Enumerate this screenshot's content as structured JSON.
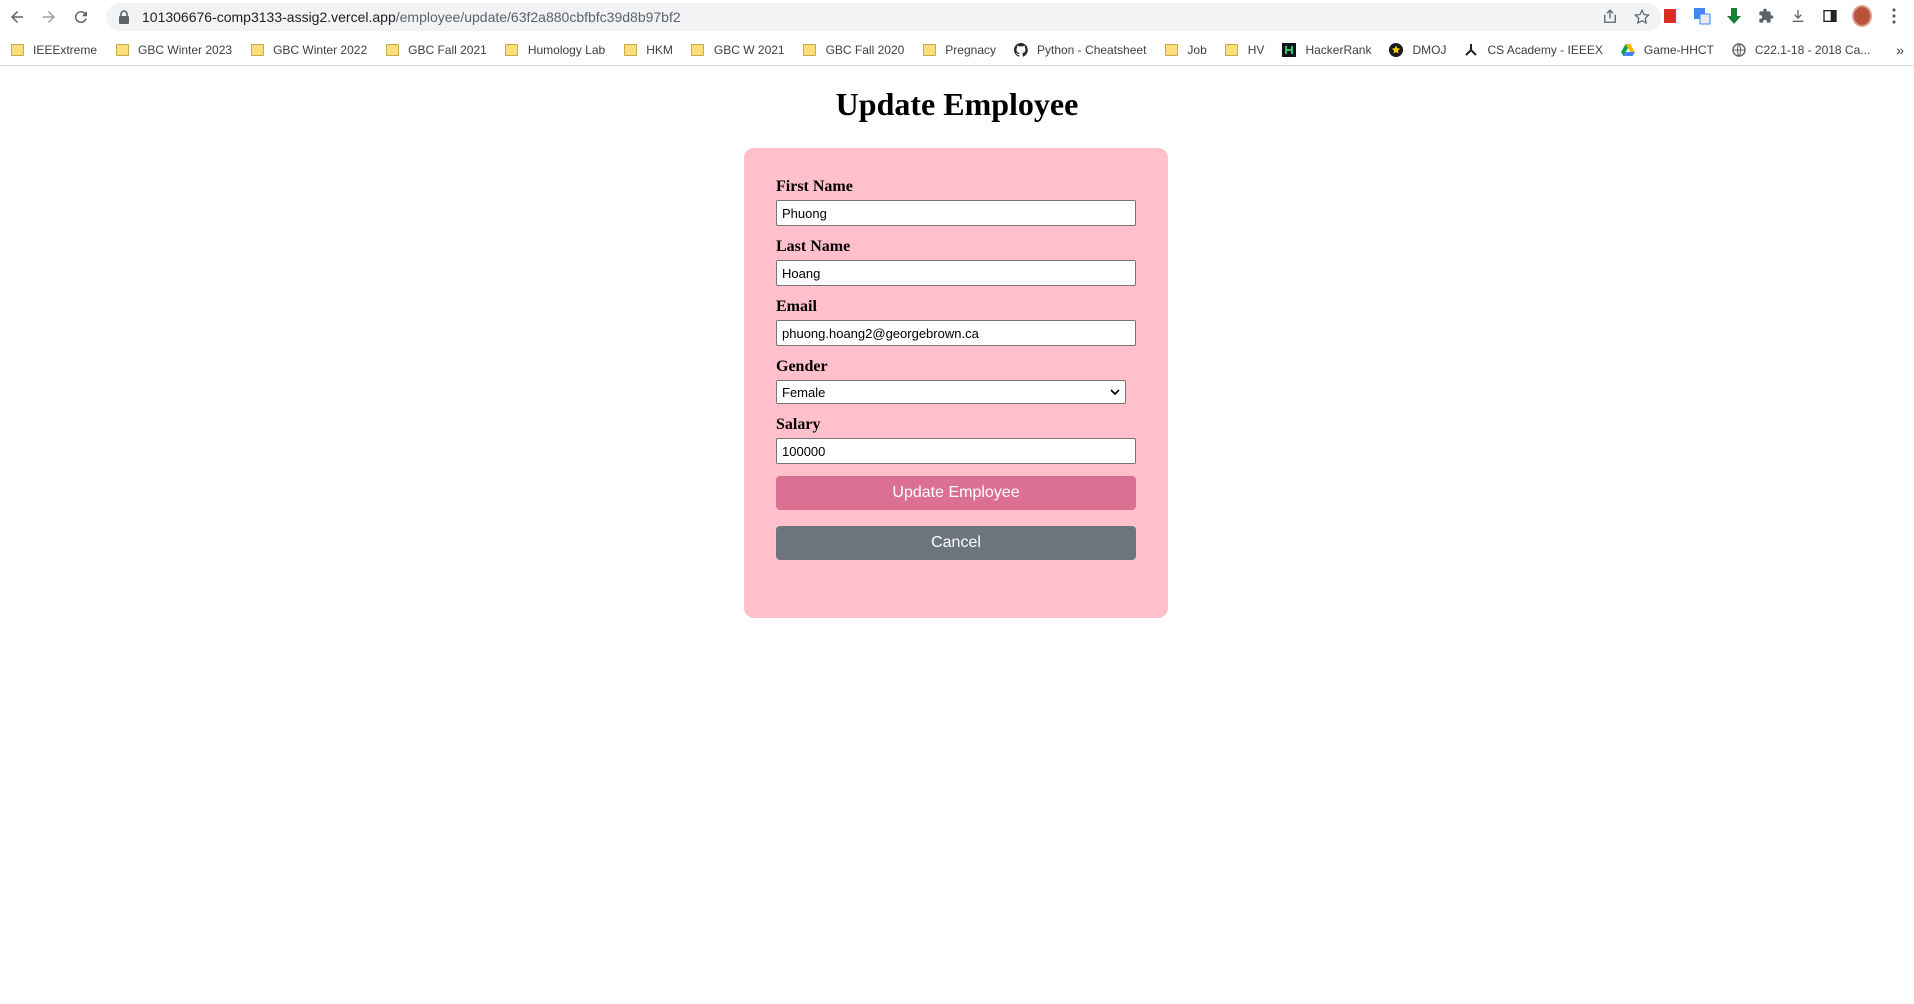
{
  "browser": {
    "url_host": "101306676-comp3133-assig2.vercel.app",
    "url_path": "/employee/update/63f2a880cbfbfc39d8b97bf2",
    "bookmarks": [
      {
        "label": "IEEExtreme",
        "icon": "folder-icon"
      },
      {
        "label": "GBC Winter 2023",
        "icon": "folder-icon"
      },
      {
        "label": "GBC Winter 2022",
        "icon": "folder-icon"
      },
      {
        "label": "GBC Fall 2021",
        "icon": "folder-icon"
      },
      {
        "label": "Humology Lab",
        "icon": "folder-icon"
      },
      {
        "label": "HKM",
        "icon": "folder-icon"
      },
      {
        "label": "GBC W 2021",
        "icon": "folder-icon"
      },
      {
        "label": "GBC Fall 2020",
        "icon": "folder-icon"
      },
      {
        "label": "Pregnacy",
        "icon": "folder-icon"
      },
      {
        "label": "Python - Cheatsheet",
        "icon": "github-icon"
      },
      {
        "label": "Job",
        "icon": "folder-icon"
      },
      {
        "label": "HV",
        "icon": "folder-icon"
      },
      {
        "label": "HackerRank",
        "icon": "hackerrank-icon"
      },
      {
        "label": "DMOJ",
        "icon": "dmoj-icon"
      },
      {
        "label": "CS Academy - IEEEX",
        "icon": "csacademy-icon"
      },
      {
        "label": "Game-HHCT",
        "icon": "google-drive-icon"
      },
      {
        "label": "C22.1-18 - 2018 Ca...",
        "icon": "globe-icon"
      }
    ],
    "bookmarks_overflow": "»"
  },
  "page": {
    "title": "Update Employee"
  },
  "form": {
    "first_name_label": "First Name",
    "first_name_value": "Phuong",
    "last_name_label": "Last Name",
    "last_name_value": "Hoang",
    "email_label": "Email",
    "email_value": "phuong.hoang2@georgebrown.ca",
    "gender_label": "Gender",
    "gender_value": "Female",
    "salary_label": "Salary",
    "salary_value": "100000",
    "update_button": "Update Employee",
    "cancel_button": "Cancel"
  },
  "colors": {
    "card_bg": "#ffc0cb",
    "update_button_bg": "#db7093",
    "cancel_button_bg": "#6c757d"
  }
}
